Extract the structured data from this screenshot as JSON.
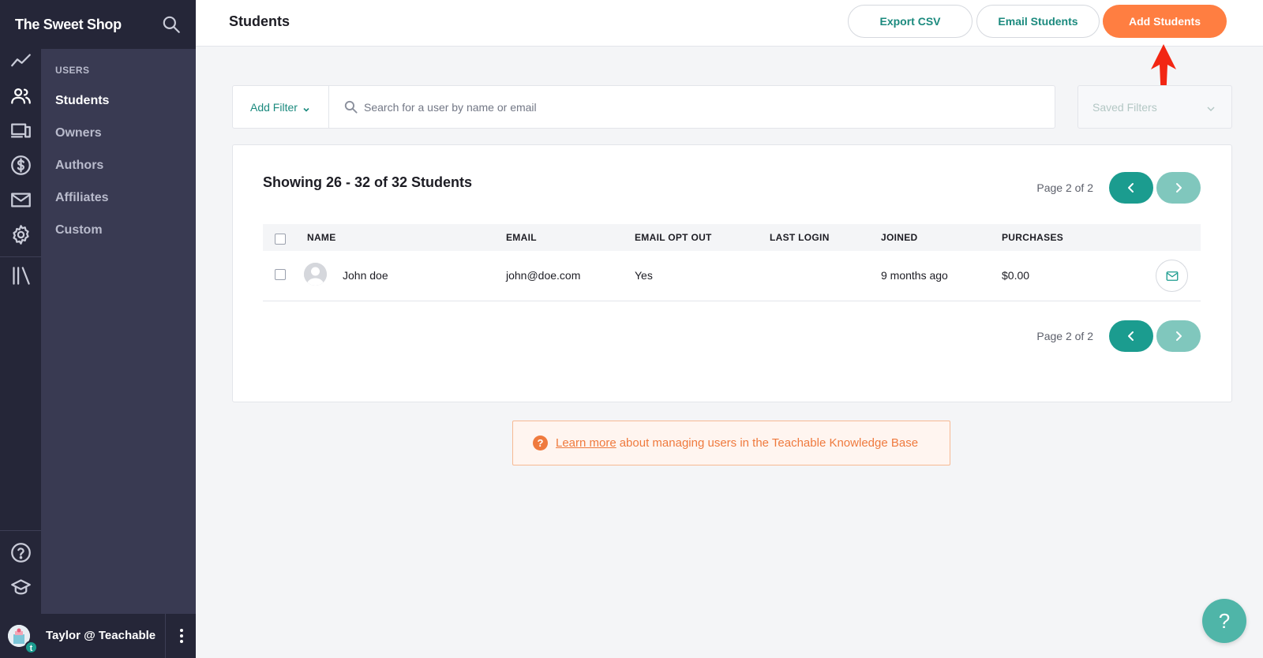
{
  "brand": {
    "name": "The Sweet Shop"
  },
  "header": {
    "title": "Students",
    "export_label": "Export CSV",
    "email_label": "Email Students",
    "add_label": "Add Students"
  },
  "sidebar": {
    "section_heading": "USERS",
    "items": [
      {
        "label": "Students",
        "active": true
      },
      {
        "label": "Owners",
        "active": false
      },
      {
        "label": "Authors",
        "active": false
      },
      {
        "label": "Affiliates",
        "active": false
      },
      {
        "label": "Custom",
        "active": false
      }
    ],
    "rail_icons": [
      "analytics-icon",
      "users-icon",
      "devices-icon",
      "dollar-icon",
      "mail-icon",
      "settings-icon",
      "library-icon",
      "help-circle-icon",
      "graduation-cap-icon"
    ],
    "user_name": "Taylor @ Teachable",
    "user_badge": "t"
  },
  "filters": {
    "add_filter_label": "Add Filter",
    "search_placeholder": "Search for a user by name or email",
    "search_value": "",
    "saved_filters_label": "Saved Filters"
  },
  "table": {
    "showing_text": "Showing 26 - 32 of 32 Students",
    "page_text": "Page 2 of 2",
    "columns": [
      "NAME",
      "EMAIL",
      "EMAIL OPT OUT",
      "LAST LOGIN",
      "JOINED",
      "PURCHASES"
    ],
    "rows": [
      {
        "name": "John doe",
        "email": "john@doe.com",
        "opt_out": "Yes",
        "last_login": "",
        "joined": "9 months ago",
        "purchases": "$0.00"
      }
    ]
  },
  "notice": {
    "link_text": "Learn more",
    "text": "about managing users in the Teachable Knowledge Base",
    "icon": "?"
  },
  "help_fab": {
    "label": "?"
  },
  "colors": {
    "sidebar_dark": "#252638",
    "sidebar_panel": "#393a52",
    "accent_teal": "#1b9c8f",
    "accent_orange": "#ff7e41",
    "annotation_red": "#f22613"
  }
}
